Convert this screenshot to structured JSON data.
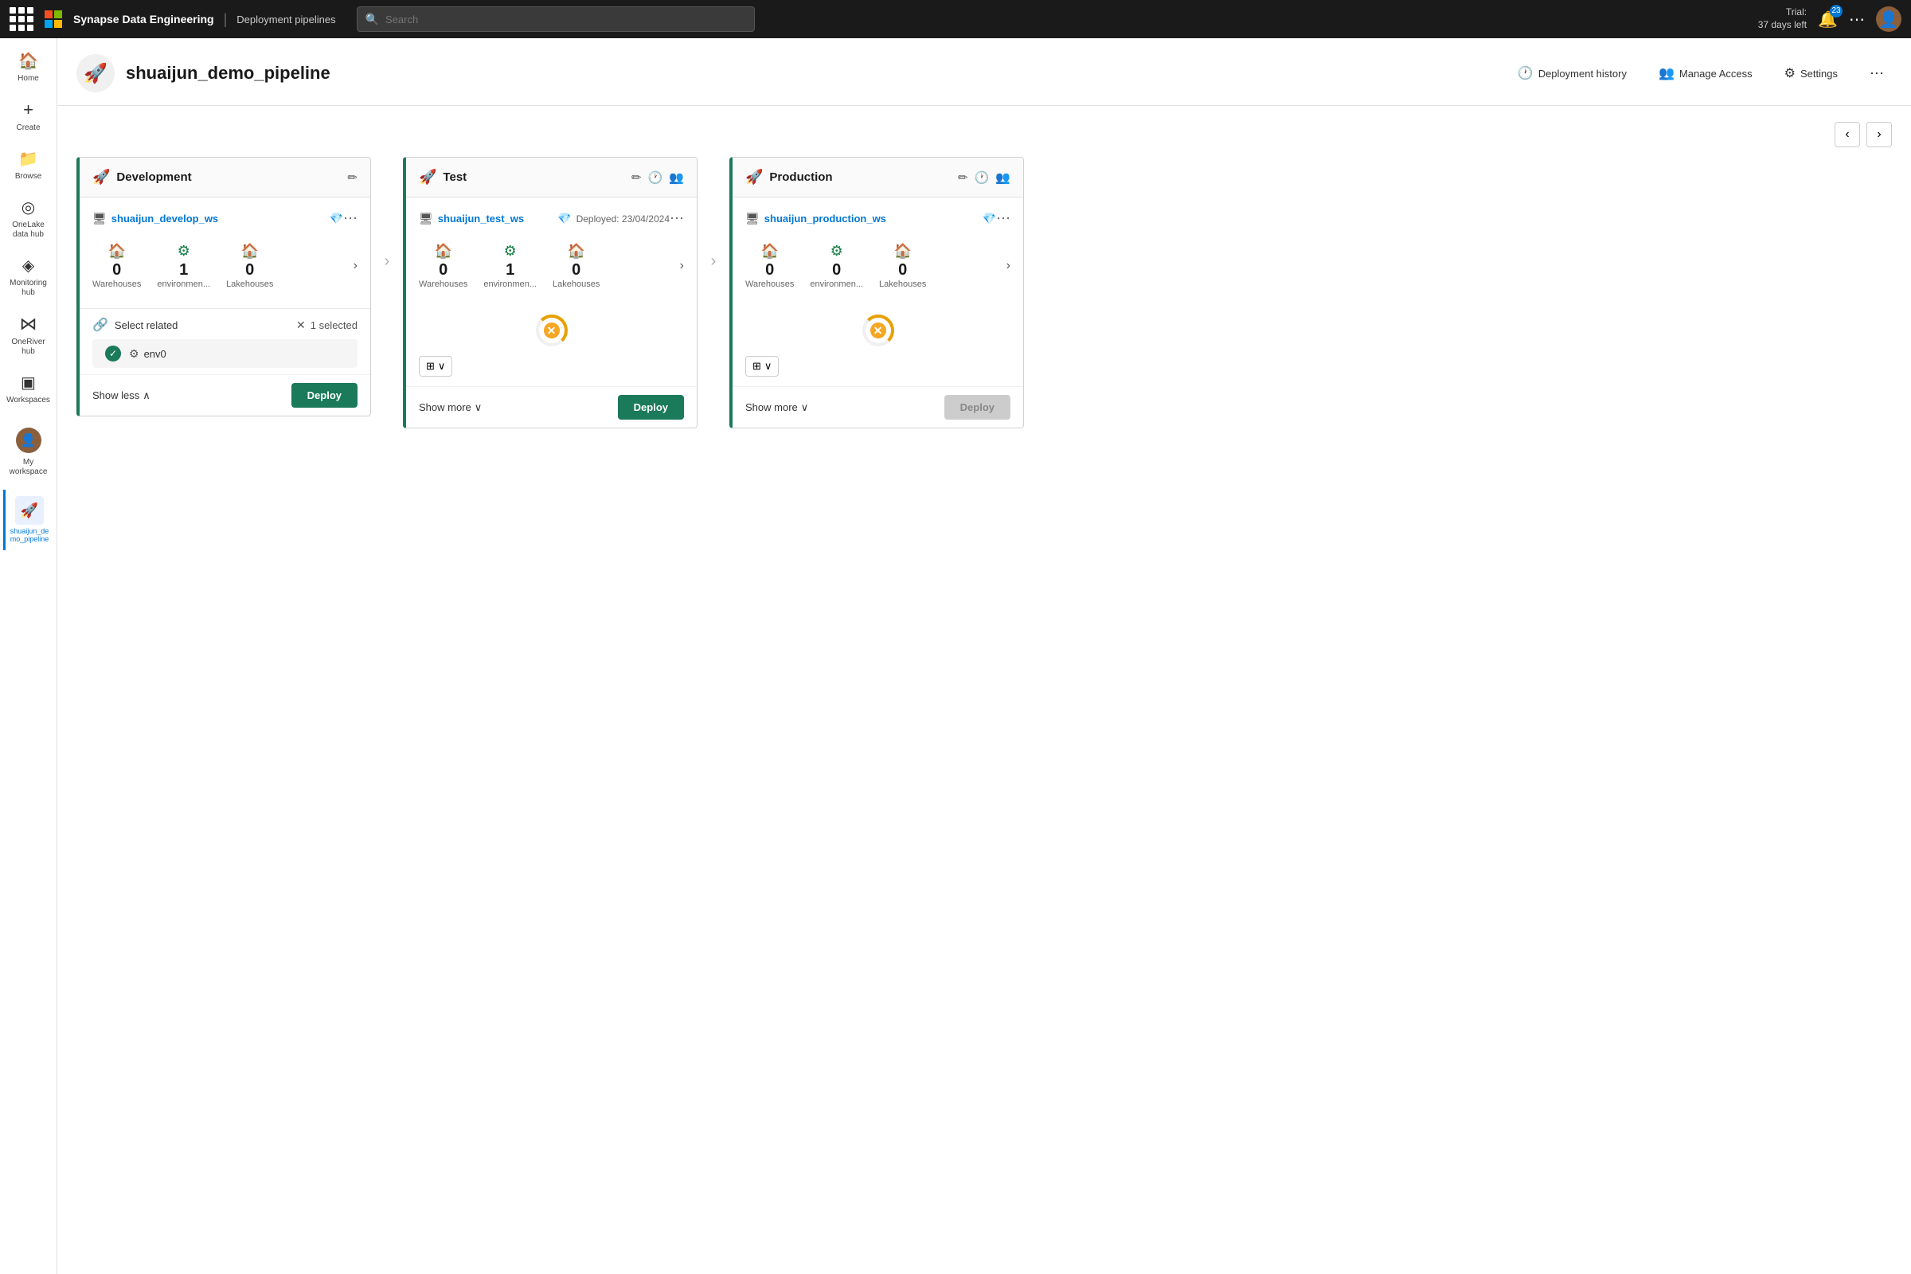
{
  "topbar": {
    "app_name": "Synapse Data Engineering",
    "section": "Deployment pipelines",
    "search_placeholder": "Search",
    "trial_line1": "Trial:",
    "trial_line2": "37 days left",
    "notif_count": "23",
    "grid_dots": 9
  },
  "sidebar": {
    "items": [
      {
        "id": "home",
        "label": "Home",
        "icon": "⌂"
      },
      {
        "id": "create",
        "label": "Create",
        "icon": "+"
      },
      {
        "id": "browse",
        "label": "Browse",
        "icon": "▦"
      },
      {
        "id": "onelake",
        "label": "OneLake data hub",
        "icon": "◎"
      },
      {
        "id": "monitoring",
        "label": "Monitoring hub",
        "icon": "◈"
      },
      {
        "id": "oneriver",
        "label": "OneRiver hub",
        "icon": "⋈"
      },
      {
        "id": "workspaces",
        "label": "Workspaces",
        "icon": "▣"
      }
    ],
    "workspace_label": "My workspace",
    "pipeline_label": "shuaijun_de mo_pipeline"
  },
  "page": {
    "title": "shuaijun_demo_pipeline",
    "icon": "🚀"
  },
  "header_actions": {
    "deployment_history": "Deployment history",
    "manage_access": "Manage Access",
    "settings": "Settings"
  },
  "stages": [
    {
      "id": "development",
      "title": "Development",
      "icon": "🚀",
      "workspace_name": "shuaijun_develop_ws",
      "workspace_icon": "⬡",
      "has_diamond": true,
      "deployed_date": null,
      "metrics": [
        {
          "id": "warehouses",
          "value": "0",
          "label": "Warehouses",
          "icon": "🏠"
        },
        {
          "id": "environments",
          "value": "1",
          "label": "environmen...",
          "icon": "⚙"
        },
        {
          "id": "lakehouses",
          "value": "0",
          "label": "Lakehouses",
          "icon": "🏠"
        }
      ],
      "has_spinner": false,
      "show_button": "Show less",
      "show_button_direction": "up",
      "deploy_button": "Deploy",
      "deploy_enabled": true,
      "has_select_related": true,
      "selected_count": "1 selected",
      "selected_items": [
        {
          "name": "env0",
          "icon": "⚙"
        }
      ],
      "has_dropdown": false
    },
    {
      "id": "test",
      "title": "Test",
      "icon": "🚀",
      "workspace_name": "shuaijun_test_ws",
      "workspace_icon": "⬡",
      "has_diamond": true,
      "deployed_date": "Deployed: 23/04/2024",
      "metrics": [
        {
          "id": "warehouses",
          "value": "0",
          "label": "Warehouses",
          "icon": "🏠"
        },
        {
          "id": "environments",
          "value": "1",
          "label": "environmen...",
          "icon": "⚙"
        },
        {
          "id": "lakehouses",
          "value": "0",
          "label": "Lakehouses",
          "icon": "🏠"
        }
      ],
      "has_spinner": true,
      "show_button": "Show more",
      "show_button_direction": "down",
      "deploy_button": "Deploy",
      "deploy_enabled": true,
      "has_select_related": false,
      "selected_items": [],
      "has_dropdown": true
    },
    {
      "id": "production",
      "title": "Production",
      "icon": "🚀",
      "workspace_name": "shuaijun_production_ws",
      "workspace_icon": "⬡",
      "has_diamond": true,
      "deployed_date": null,
      "metrics": [
        {
          "id": "warehouses",
          "value": "0",
          "label": "Warehouses",
          "icon": "🏠"
        },
        {
          "id": "environments",
          "value": "0",
          "label": "environmen...",
          "icon": "⚙"
        },
        {
          "id": "lakehouses",
          "value": "0",
          "label": "Lakehouses",
          "icon": "🏠"
        }
      ],
      "has_spinner": true,
      "show_button": "Show more",
      "show_button_direction": "down",
      "deploy_button": "Deploy",
      "deploy_enabled": false,
      "has_select_related": false,
      "selected_items": [],
      "has_dropdown": true
    }
  ]
}
